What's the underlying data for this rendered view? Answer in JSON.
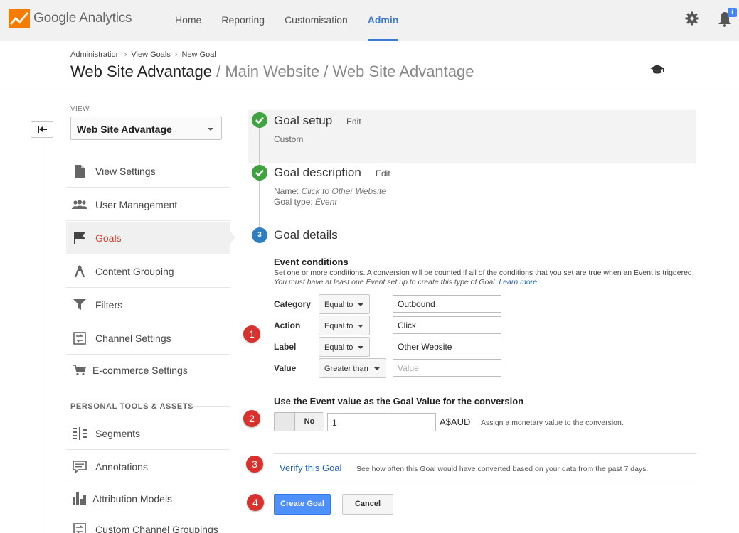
{
  "brand": {
    "name": "Google Analytics",
    "accent": "#3a7ad8"
  },
  "nav": {
    "items": [
      {
        "label": "Home"
      },
      {
        "label": "Reporting"
      },
      {
        "label": "Customisation"
      },
      {
        "label": "Admin"
      }
    ],
    "active": "Admin"
  },
  "notifications": {
    "badge": "i"
  },
  "breadcrumb": {
    "items": [
      "Administration",
      "View Goals",
      "New Goal"
    ]
  },
  "header": {
    "title": "Web Site Advantage",
    "subtitle": "/ Main Website / Web Site Advantage"
  },
  "sidebar": {
    "view_label": "VIEW",
    "view_value": "Web Site Advantage",
    "items": [
      {
        "label": "View Settings",
        "icon": "document-icon"
      },
      {
        "label": "User Management",
        "icon": "users-icon"
      },
      {
        "label": "Goals",
        "icon": "flag-icon"
      },
      {
        "label": "Content Grouping",
        "icon": "grouping-icon"
      },
      {
        "label": "Filters",
        "icon": "filter-icon"
      },
      {
        "label": "Channel Settings",
        "icon": "channel-icon"
      },
      {
        "label": "E-commerce Settings",
        "icon": "cart-icon"
      }
    ],
    "section_label": "PERSONAL TOOLS & ASSETS",
    "tools": [
      {
        "label": "Segments",
        "icon": "segments-icon"
      },
      {
        "label": "Annotations",
        "icon": "annotation-icon"
      },
      {
        "label": "Attribution Models",
        "icon": "bar-chart-icon"
      },
      {
        "label": "Custom Channel Groupings",
        "icon": "channel-icon"
      }
    ]
  },
  "steps": {
    "setup": {
      "title": "Goal setup",
      "edit": "Edit",
      "value": "Custom"
    },
    "description": {
      "title": "Goal description",
      "edit": "Edit",
      "name_label": "Name:",
      "name_value": "Click to Other Website",
      "type_label": "Goal type:",
      "type_value": "Event"
    },
    "details": {
      "number": "3",
      "title": "Goal details"
    }
  },
  "event_conditions": {
    "title": "Event conditions",
    "desc": "Set one or more conditions. A conversion will be counted if all of the conditions that you set are true when an Event is triggered.",
    "desc2": "You must have at least one Event set up to create this type of Goal.",
    "learn_more": "Learn more",
    "rows": [
      {
        "label": "Category",
        "operator": "Equal to",
        "value": "Outbound",
        "placeholder": ""
      },
      {
        "label": "Action",
        "operator": "Equal to",
        "value": "Click",
        "placeholder": ""
      },
      {
        "label": "Label",
        "operator": "Equal to",
        "value": "Other Website",
        "placeholder": ""
      },
      {
        "label": "Value",
        "operator": "Greater than",
        "value": "",
        "placeholder": "Value"
      }
    ]
  },
  "goal_value": {
    "title": "Use the Event value as the Goal Value for the conversion",
    "toggle_label": "No",
    "amount": "1",
    "currency": "A$AUD",
    "hint": "Assign a monetary value to the conversion."
  },
  "verify": {
    "link": "Verify this Goal",
    "hint": "See how often this Goal would have converted based on your data from the past 7 days."
  },
  "actions": {
    "create": "Create Goal",
    "cancel": "Cancel"
  },
  "markers": [
    "1",
    "2",
    "3",
    "4"
  ]
}
